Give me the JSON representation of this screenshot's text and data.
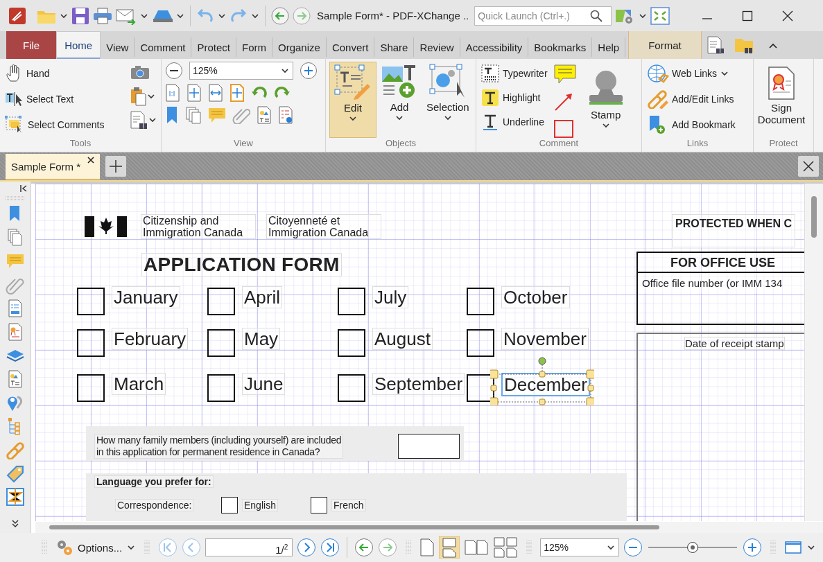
{
  "title_bar": {
    "title": "Sample Form* - PDF-XChange ..",
    "quick_launch": {
      "placeholder": "Quick Launch (Ctrl+.)"
    }
  },
  "menu_tabs": [
    {
      "label": "File",
      "kind": "file",
      "selected": false
    },
    {
      "label": "Home",
      "kind": "tab",
      "selected": true
    },
    {
      "label": "View",
      "kind": "tab",
      "selected": false
    },
    {
      "label": "Comment",
      "kind": "tab",
      "selected": false
    },
    {
      "label": "Protect",
      "kind": "tab",
      "selected": false
    },
    {
      "label": "Form",
      "kind": "tab",
      "selected": false
    },
    {
      "label": "Organize",
      "kind": "tab",
      "selected": false
    },
    {
      "label": "Convert",
      "kind": "tab",
      "selected": false
    },
    {
      "label": "Share",
      "kind": "tab",
      "selected": false
    },
    {
      "label": "Review",
      "kind": "tab",
      "selected": false
    },
    {
      "label": "Accessibility",
      "kind": "tab",
      "selected": false
    },
    {
      "label": "Bookmarks",
      "kind": "tab",
      "selected": false
    },
    {
      "label": "Help",
      "kind": "tab",
      "selected": false
    },
    {
      "label": "Format",
      "kind": "contextual",
      "selected": false
    }
  ],
  "ribbon": {
    "tools": {
      "label": "Tools",
      "items": [
        "Hand",
        "Select Text",
        "Select Comments"
      ]
    },
    "view": {
      "label": "View",
      "zoom": "125%"
    },
    "objects": {
      "label": "Objects",
      "items": [
        {
          "label": "Edit",
          "selected": true
        },
        {
          "label": "Add",
          "selected": false
        },
        {
          "label": "Selection",
          "selected": false
        }
      ]
    },
    "comment": {
      "label": "Comment",
      "items": [
        "Typewriter",
        "Highlight",
        "Underline"
      ],
      "stamp": "Stamp"
    },
    "links": {
      "label": "Links",
      "items": [
        "Web Links",
        "Add/Edit Links",
        "Add Bookmark"
      ]
    },
    "protect": {
      "label": "Protect",
      "items": [
        "Sign Document"
      ]
    }
  },
  "document_tab": {
    "label": "Sample Form *",
    "selected": true
  },
  "page": {
    "header": [
      "Citizenship and Immigration Canada",
      "Citoyenneté et Immigration Canada"
    ],
    "title": "APPLICATION FORM",
    "months": [
      {
        "label": "January",
        "checked": false,
        "selected": false
      },
      {
        "label": "February",
        "checked": false,
        "selected": false
      },
      {
        "label": "March",
        "checked": false,
        "selected": false
      },
      {
        "label": "April",
        "checked": false,
        "selected": false
      },
      {
        "label": "May",
        "checked": false,
        "selected": false
      },
      {
        "label": "June",
        "checked": false,
        "selected": false
      },
      {
        "label": "July",
        "checked": false,
        "selected": false
      },
      {
        "label": "August",
        "checked": false,
        "selected": false
      },
      {
        "label": "September",
        "checked": false,
        "selected": false
      },
      {
        "label": "October",
        "checked": false,
        "selected": false
      },
      {
        "label": "November",
        "checked": false,
        "selected": false
      },
      {
        "label": "December",
        "checked": false,
        "selected": true
      }
    ],
    "question": "How many family members (including yourself) are included\nin this application for permanent residence in Canada?",
    "language": {
      "heading": "Language you prefer for:",
      "label": "Correspondence:",
      "options": [
        {
          "label": "English",
          "checked": false
        },
        {
          "label": "French",
          "checked": false
        }
      ]
    },
    "protected": "PROTECTED WHEN C",
    "office": {
      "heading": "FOR OFFICE USE",
      "field": "Office file number (or IMM 134"
    },
    "stamp_box": "Date of receipt stamp"
  },
  "status_bar": {
    "options": "Options...",
    "page": "1/$^{2}$",
    "zoom": "125%",
    "zoom_slider": {
      "level": 0.5
    }
  }
}
